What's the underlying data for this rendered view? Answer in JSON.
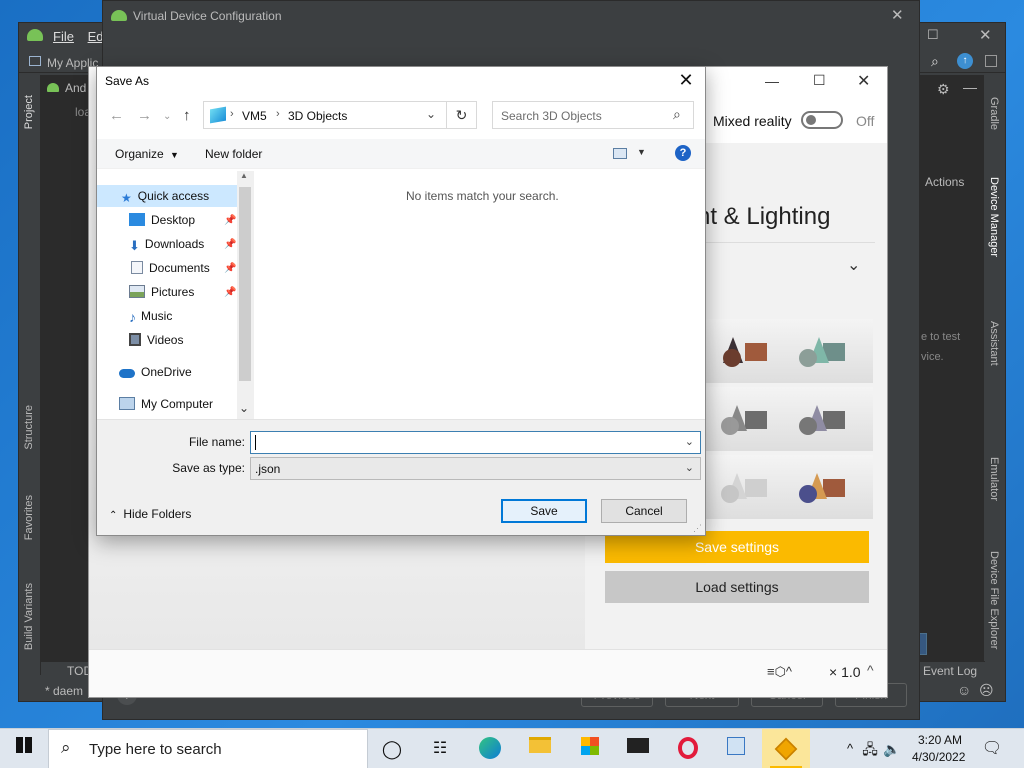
{
  "studio": {
    "menu": [
      "File",
      "Edit"
    ],
    "project_crumb": "My Applic",
    "tree_item": "And",
    "tree_item2": "loa",
    "left_tabs": [
      "Project",
      "Structure",
      "Favorites",
      "Build Variants"
    ],
    "right_tabs": [
      "Gradle",
      "Device Manager",
      "Assistant",
      "Emulator",
      "Device File Explorer"
    ],
    "actions_label": "Actions",
    "hint_text": "e to test",
    "hint_text2": "vice.",
    "todo_label": "TOD",
    "daemon_label": "* daem",
    "event_log": "Event Log"
  },
  "vdc": {
    "title": "Virtual Device Configuration",
    "buttons": {
      "previous": "Previous",
      "next": "Next",
      "cancel": "Cancel",
      "finish": "Finish"
    }
  },
  "ext": {
    "mixed_reality_label": "Mixed reality",
    "mixed_reality_state": "Off",
    "section_title": "nt & Lighting",
    "save_settings": "Save settings",
    "load_settings": "Load settings",
    "zoom": "× 1.0"
  },
  "saveas": {
    "title": "Save As",
    "breadcrumb": [
      "VM5",
      "3D Objects"
    ],
    "search_placeholder": "Search 3D Objects",
    "organize": "Organize",
    "new_folder": "New folder",
    "empty_message": "No items match your search.",
    "nav": {
      "quick_access": "Quick access",
      "desktop": "Desktop",
      "downloads": "Downloads",
      "documents": "Documents",
      "pictures": "Pictures",
      "music": "Music",
      "videos": "Videos",
      "onedrive": "OneDrive",
      "my_computer": "My Computer"
    },
    "file_name_label": "File name:",
    "file_name_value": "",
    "save_as_type_label": "Save as type:",
    "save_as_type_value": ".json",
    "hide_folders": "Hide Folders",
    "save": "Save",
    "cancel": "Cancel"
  },
  "taskbar": {
    "search_placeholder": "Type here to search",
    "time": "3:20 AM",
    "date": "4/30/2022"
  },
  "colors": {
    "accent_yellow": "#fbba00",
    "win_blue": "#0078d7",
    "studio_dark": "#3c3f41"
  }
}
